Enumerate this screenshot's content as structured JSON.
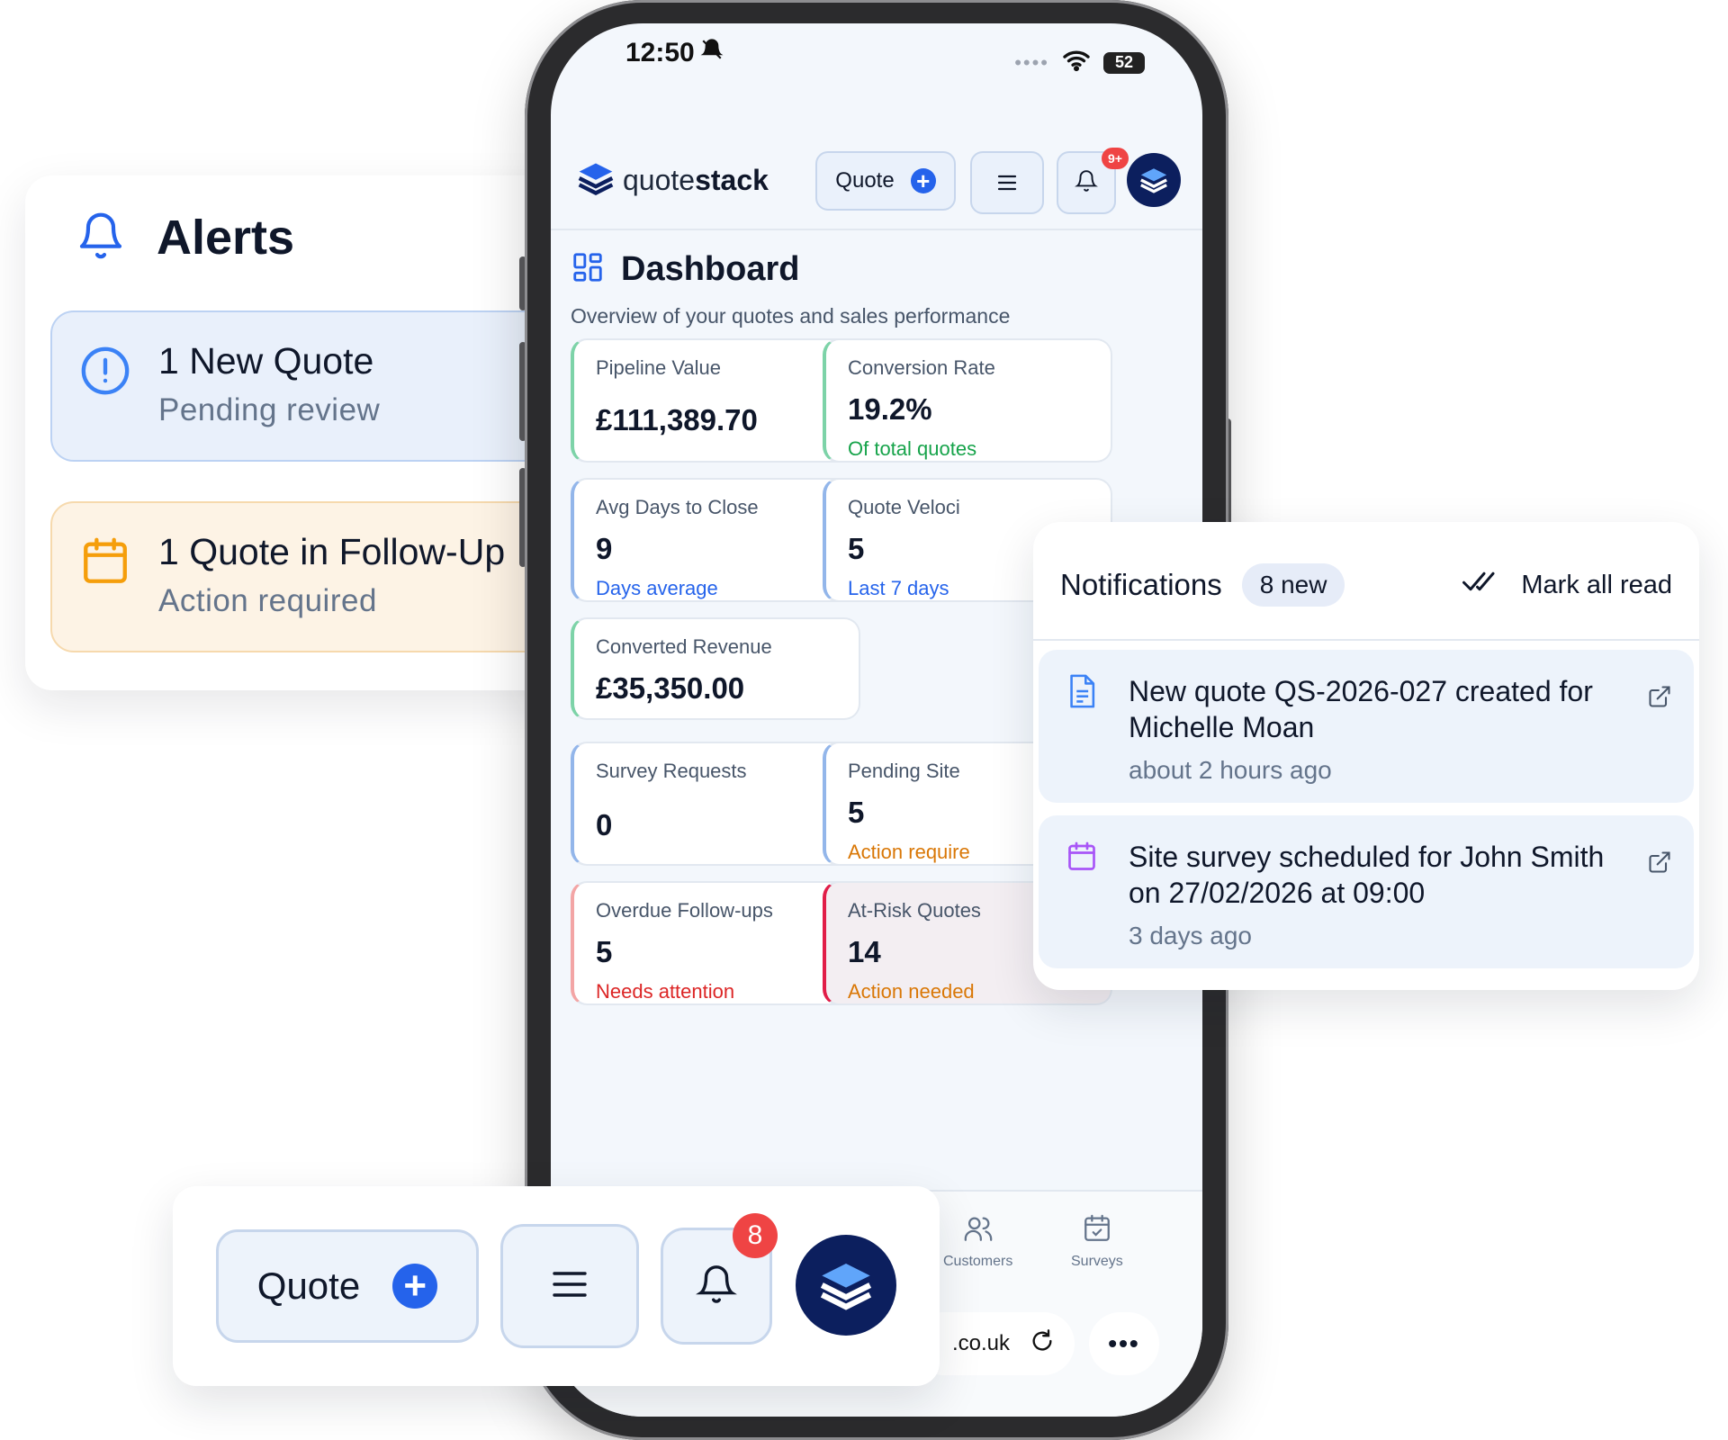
{
  "alerts": {
    "title": "Alerts",
    "items": [
      {
        "title": "1 New Quote",
        "subtitle": "Pending review",
        "icon": "info-circle-icon",
        "color": "#3b82f6"
      },
      {
        "title": "1 Quote in Follow-Up",
        "subtitle": "Action required",
        "icon": "calendar-icon",
        "color": "#f59e0b"
      }
    ]
  },
  "phone": {
    "status": {
      "time": "12:50",
      "battery": "52"
    },
    "header": {
      "logo_prefix": "quote",
      "logo_bold": "stack",
      "quote_button": "Quote",
      "notif_badge": "9+"
    },
    "dashboard": {
      "title": "Dashboard",
      "subtitle": "Overview of your quotes and sales performance",
      "stats": [
        {
          "label": "Pipeline Value",
          "value": "£111,389.70",
          "note": ""
        },
        {
          "label": "Conversion Rate",
          "value": "19.2%",
          "note": "Of total quotes"
        },
        {
          "label": "Avg Days to Close",
          "value": "9",
          "note": "Days average"
        },
        {
          "label": "Quote Veloci",
          "value": "5",
          "note": "Last 7 days"
        },
        {
          "label": "Converted Revenue",
          "value": "£35,350.00",
          "note": ""
        },
        {
          "label": "Survey Requests",
          "value": "0",
          "note": ""
        },
        {
          "label": "Pending Site",
          "value": "5",
          "note": "Action require"
        },
        {
          "label": "Overdue Follow-ups",
          "value": "5",
          "note": "Needs attention"
        },
        {
          "label": "At-Risk Quotes",
          "value": "14",
          "note": "Action needed"
        }
      ]
    },
    "bottom_nav": {
      "customers": "Customers",
      "surveys": "Surveys",
      "url": ".co.uk"
    }
  },
  "notifications": {
    "title": "Notifications",
    "badge": "8 new",
    "mark_all": "Mark all read",
    "items": [
      {
        "text": "New quote QS-2026-027 created for Michelle Moan",
        "time": "about 2 hours ago"
      },
      {
        "text": "Site survey scheduled for John Smith on 27/02/2026 at 09:00",
        "time": "3 days ago"
      }
    ]
  },
  "toolbar": {
    "quote_button": "Quote",
    "notif_count": "8"
  },
  "colors": {
    "primary": "#2563eb",
    "navy": "#0c1f5e",
    "success": "#16a34a",
    "warning": "#d97706",
    "danger": "#dc2626"
  }
}
